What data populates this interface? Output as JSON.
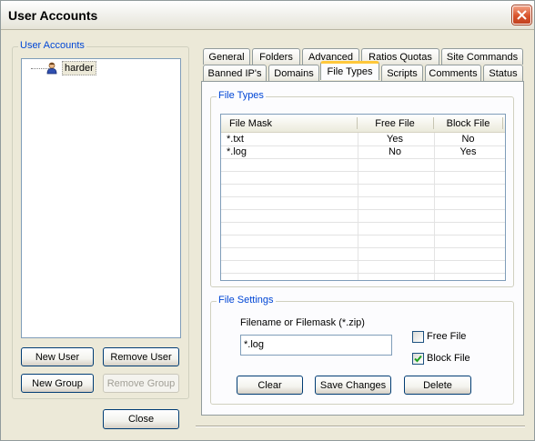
{
  "window": {
    "title": "User Accounts"
  },
  "accounts": {
    "group_label": "User Accounts",
    "tree": [
      {
        "label": "harder",
        "icon": "user-icon"
      }
    ],
    "buttons": {
      "new_user": "New User",
      "remove_user": "Remove User",
      "new_group": "New Group",
      "remove_group": "Remove Group"
    }
  },
  "close_label": "Close",
  "tabs": {
    "row1": [
      "General",
      "Folders",
      "Advanced",
      "Ratios  Quotas",
      "Site Commands"
    ],
    "row2": [
      "Banned IP's",
      "Domains",
      "File Types",
      "Scripts",
      "Comments",
      "Status"
    ],
    "active": "File Types"
  },
  "file_types": {
    "group_label": "File Types",
    "columns": [
      "File Mask",
      "Free File",
      "Block File"
    ],
    "rows": [
      {
        "mask": "*.txt",
        "free": "Yes",
        "block": "No"
      },
      {
        "mask": "*.log",
        "free": "No",
        "block": "Yes"
      }
    ]
  },
  "file_settings": {
    "group_label": "File Settings",
    "field_label": "Filename or Filemask (*.zip)",
    "field_value": "*.log",
    "free_file_label": "Free File",
    "free_file_checked": false,
    "block_file_label": "Block File",
    "block_file_checked": true,
    "buttons": {
      "clear": "Clear",
      "save": "Save Changes",
      "delete": "Delete"
    }
  },
  "colors": {
    "group_label": "#0046d5",
    "active_tab_accent": "#ffc83c",
    "close_button": "#d8532c"
  }
}
